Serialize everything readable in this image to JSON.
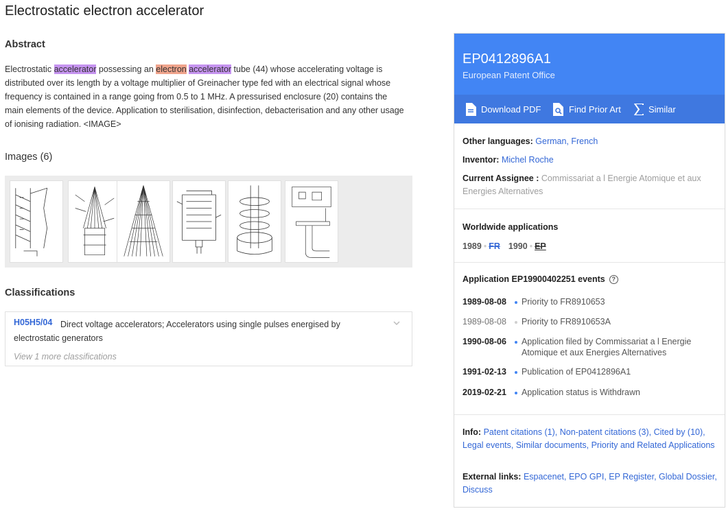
{
  "title": "Electrostatic electron accelerator",
  "abstract": {
    "heading": "Abstract",
    "parts": {
      "p1": "Electrostatic ",
      "h1": "accelerator",
      "p2": " possessing an ",
      "h2": "electron",
      "p3": " ",
      "h3": "accelerator",
      "p4": " tube (44) whose accelerating voltage is distributed over its length by a voltage multiplier of Greinacher type fed with an electrical signal whose frequency is contained in a range going from 0.5 to 1 MHz. A pressurised enclosure (20) contains the main elements of the device. Application to sterilisation, disinfection, debacterisation and any other usage of ionising radiation. <IMAGE>"
    }
  },
  "images": {
    "heading": "Images (6)"
  },
  "classifications": {
    "heading": "Classifications",
    "code": "H05H5/04",
    "description": "Direct voltage accelerators; Accelerators using single pulses energised by electrostatic generators",
    "more": "View 1 more classifications"
  },
  "panel": {
    "publication_number": "EP0412896A1",
    "office": "European Patent Office",
    "actions": {
      "download": "Download PDF",
      "prior_art": "Find Prior Art",
      "similar": "Similar"
    },
    "other_languages_label": "Other languages:",
    "other_languages": "German, French",
    "inventor_label": "Inventor:",
    "inventor": "Michel Roche",
    "assignee_label": "Current Assignee :",
    "assignee": "Commissariat a l Energie Atomique et aux Energies Alternatives",
    "worldwide_heading": "Worldwide applications",
    "worldwide": {
      "y1": "1989",
      "c1": "FR",
      "y2": "1990",
      "c2": "EP"
    },
    "events_heading": "Application EP19900402251 events",
    "events": [
      {
        "date": "1989-08-08",
        "text": "Priority to FR8910653"
      },
      {
        "date": "1989-08-08",
        "text": "Priority to FR8910653A"
      },
      {
        "date": "1990-08-06",
        "text": "Application filed by Commissariat a l Energie Atomique et aux Energies Alternatives"
      },
      {
        "date": "1991-02-13",
        "text": "Publication of EP0412896A1"
      },
      {
        "date": "2019-02-21",
        "text": "Application status is Withdrawn"
      }
    ],
    "info_label": "Info:",
    "info_links": "Patent citations (1), Non-patent citations (3), Cited by (10), Legal events, Similar documents, Priority and Related Applications",
    "external_label": "External links:",
    "external_links": "Espacenet, EPO GPI, EP Register, Global Dossier, Discuss"
  }
}
